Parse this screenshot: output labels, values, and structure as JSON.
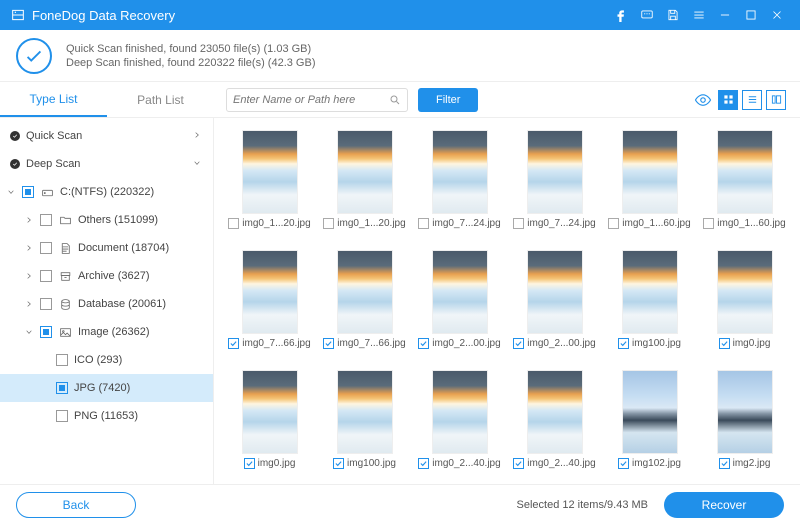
{
  "app_title": "FoneDog Data Recovery",
  "scan": {
    "line1": "Quick Scan finished, found 23050 file(s) (1.03 GB)",
    "line2": "Deep Scan finished, found 220322 file(s) (42.3 GB)"
  },
  "tabs": {
    "type_list": "Type List",
    "path_list": "Path List",
    "active": "type_list"
  },
  "search": {
    "placeholder": "Enter Name or Path here"
  },
  "filter_label": "Filter",
  "sidebar": {
    "quick_scan": "Quick Scan",
    "deep_scan": "Deep Scan",
    "drive": "C:(NTFS) (220322)",
    "others": "Others (151099)",
    "document": "Document (18704)",
    "archive": "Archive (3627)",
    "database": "Database (20061)",
    "image": "Image (26362)",
    "ico": "ICO (293)",
    "jpg": "JPG (7420)",
    "png": "PNG (11653)"
  },
  "thumbs": [
    {
      "name": "img0_1...20.jpg",
      "checked": false,
      "alt": false
    },
    {
      "name": "img0_1...20.jpg",
      "checked": false,
      "alt": false
    },
    {
      "name": "img0_7...24.jpg",
      "checked": false,
      "alt": false
    },
    {
      "name": "img0_7...24.jpg",
      "checked": false,
      "alt": false
    },
    {
      "name": "img0_1...60.jpg",
      "checked": false,
      "alt": false
    },
    {
      "name": "img0_1...60.jpg",
      "checked": false,
      "alt": false
    },
    {
      "name": "img0_7...66.jpg",
      "checked": true,
      "alt": false
    },
    {
      "name": "img0_7...66.jpg",
      "checked": true,
      "alt": false
    },
    {
      "name": "img0_2...00.jpg",
      "checked": true,
      "alt": false
    },
    {
      "name": "img0_2...00.jpg",
      "checked": true,
      "alt": false
    },
    {
      "name": "img100.jpg",
      "checked": true,
      "alt": false
    },
    {
      "name": "img0.jpg",
      "checked": true,
      "alt": false
    },
    {
      "name": "img0.jpg",
      "checked": true,
      "alt": false
    },
    {
      "name": "img100.jpg",
      "checked": true,
      "alt": false
    },
    {
      "name": "img0_2...40.jpg",
      "checked": true,
      "alt": false
    },
    {
      "name": "img0_2...40.jpg",
      "checked": true,
      "alt": false
    },
    {
      "name": "img102.jpg",
      "checked": true,
      "alt": true
    },
    {
      "name": "img2.jpg",
      "checked": true,
      "alt": true
    }
  ],
  "footer": {
    "back": "Back",
    "status": "Selected 12 items/9.43 MB",
    "recover": "Recover"
  }
}
